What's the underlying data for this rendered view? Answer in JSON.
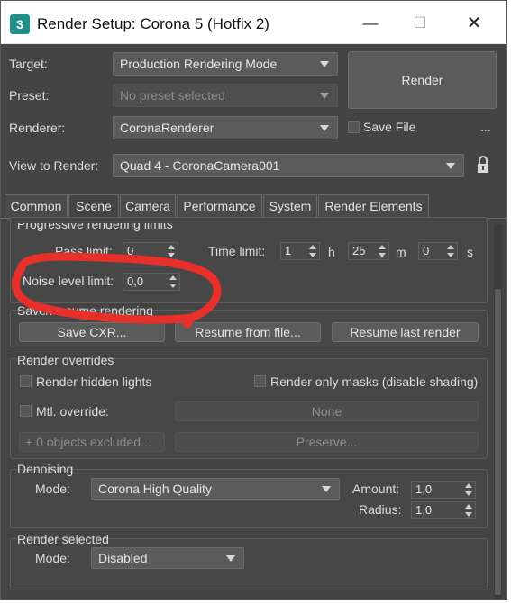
{
  "window": {
    "title": "Render Setup: Corona 5 (Hotfix 2)",
    "icon_text": "3",
    "min_glyph": "—",
    "max_glyph": "☐",
    "close_glyph": "✕"
  },
  "header": {
    "target_label": "Target:",
    "target_value": "Production Rendering Mode",
    "preset_label": "Preset:",
    "preset_value": "No preset selected",
    "renderer_label": "Renderer:",
    "renderer_value": "CoronaRenderer",
    "render_button": "Render",
    "save_file_label": "Save File",
    "more_label": "...",
    "view_label": "View to Render:",
    "view_value": "Quad 4 - CoronaCamera001"
  },
  "tabs": [
    {
      "label": "Common"
    },
    {
      "label": "Scene",
      "active": true
    },
    {
      "label": "Camera"
    },
    {
      "label": "Performance"
    },
    {
      "label": "System"
    },
    {
      "label": "Render Elements"
    }
  ],
  "progressive": {
    "title": "Progressive rendering limits",
    "pass_limit_label": "Pass limit:",
    "pass_limit_value": "0",
    "time_limit_label": "Time limit:",
    "hours_value": "1",
    "hours_unit": "h",
    "minutes_value": "25",
    "minutes_unit": "m",
    "seconds_value": "0",
    "seconds_unit": "s",
    "noise_label": "Noise level limit:",
    "noise_value": "0,0"
  },
  "save_resume": {
    "title": "Save/Resume rendering",
    "save_cxr": "Save CXR...",
    "resume_from_file": "Resume from file...",
    "resume_last": "Resume last render"
  },
  "overrides": {
    "title": "Render overrides",
    "hidden_lights": "Render hidden lights",
    "only_masks": "Render only masks (disable shading)",
    "mtl_override": "Mtl. override:",
    "mtl_value": "None",
    "excluded_plus": "+",
    "excluded": "0 objects excluded...",
    "preserve": "Preserve..."
  },
  "denoising": {
    "title": "Denoising",
    "mode_label": "Mode:",
    "mode_value": "Corona High Quality",
    "amount_label": "Amount:",
    "amount_value": "1,0",
    "radius_label": "Radius:",
    "radius_value": "1,0"
  },
  "render_selected": {
    "title": "Render selected",
    "mode_label": "Mode:",
    "mode_value": "Disabled"
  },
  "colors": {
    "panel_bg": "#444444",
    "annotation_red": "#e8302a"
  }
}
